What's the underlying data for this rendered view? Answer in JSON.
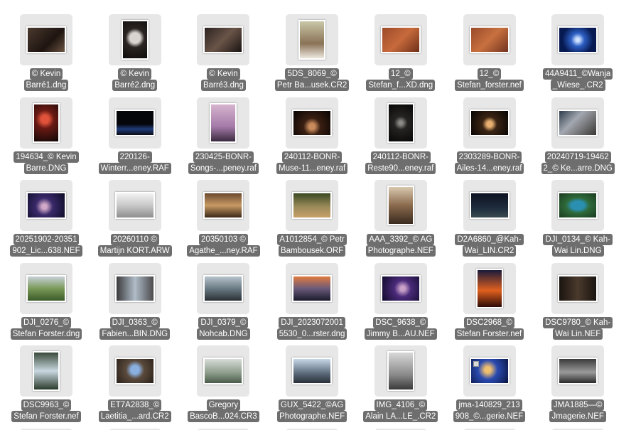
{
  "files": [
    {
      "line1": "© Kevin",
      "line2": "Barré1.dng",
      "orient": "l",
      "bg": "linear-gradient(135deg,#4a3a2e,#1e1410 60%,#6b5542)"
    },
    {
      "line1": "© Kevin",
      "line2": "Barré2.dng",
      "orient": "p",
      "bg": "radial-gradient(circle at 50% 45%,#d9d4cf 0 22%,#2a2522 40%,#0e0c0b)"
    },
    {
      "line1": "© Kevin",
      "line2": "Barré3.dng",
      "orient": "l",
      "bg": "linear-gradient(135deg,#2b2320,#6a5448 50%,#1a1412)"
    },
    {
      "line1": "5DS_8069_©",
      "line2": "Petr Ba...usek.CR2",
      "orient": "p",
      "bg": "linear-gradient(180deg,#c9c7a8,#8a7256 60%,#ece8df)"
    },
    {
      "line1": "12_©",
      "line2": "Stefan_f...XD.dng",
      "orient": "l",
      "bg": "linear-gradient(135deg,#9c4a2a,#c76a3c 50%,#6e2f18)"
    },
    {
      "line1": "12_©",
      "line2": "Stefan_forster.nef",
      "orient": "l",
      "bg": "linear-gradient(135deg,#9a4b2c,#c8703f 50%,#733420)"
    },
    {
      "line1": "44A9411_©Wanja",
      "line2": "_Wiese_.CR2",
      "orient": "l",
      "bg": "radial-gradient(circle at 50% 50%,#cfe2ff 0 8%,#2d5fc4 30%,#071a52 70%)"
    },
    {
      "line1": "194634_© Kevin",
      "line2": "Barre.DNG",
      "orient": "p",
      "bg": "radial-gradient(circle at 45% 40%,#e0533a 0 15%,#6a1a14 35%,#0d0706)"
    },
    {
      "line1": "220126-",
      "line2": "Winterr...eney.RAF",
      "orient": "l",
      "bg": "linear-gradient(180deg,#05060a 55%,#1f3c7a 75%,#0a0d16)"
    },
    {
      "line1": "230425-BONR-",
      "line2": "Songs-...peney.raf",
      "orient": "p",
      "bg": "linear-gradient(180deg,#d6b4ce,#a47aa8 60%,#3a2a40)"
    },
    {
      "line1": "240112-BONR-",
      "line2": "Muse-11...eney.raf",
      "orient": "l",
      "bg": "radial-gradient(circle at 50% 65%,#c98a5c 0 12%,#3a1f12 35%,#060403)"
    },
    {
      "line1": "240112-BONR-",
      "line2": "Reste90...eney.raf",
      "orient": "p",
      "bg": "radial-gradient(circle at 50% 50%,#8c8a86 0 8%,#262422 30%,#070707)"
    },
    {
      "line1": "2303289-BONR-",
      "line2": "Ailes-14...eney.raf",
      "orient": "l",
      "bg": "radial-gradient(circle at 50% 55%,#e8b070 0 12%,#3a2414 32%,#050403)"
    },
    {
      "line1": "20240719-19462",
      "line2": "2_© Ke...arre.DNG",
      "orient": "l",
      "bg": "linear-gradient(135deg,#2c3a4a,#a3a8b0 40%,#3b3734)"
    },
    {
      "line1": "20251902-20351",
      "line2": "902_Lic...638.NEF",
      "orient": "l",
      "bg": "radial-gradient(circle at 45% 55%,#d0a8c8 0 10%,#3a2a6a 35%,#0c0a24)"
    },
    {
      "line1": "20260110 ©",
      "line2": "Martijn KORT.ARW",
      "orient": "l",
      "bg": "linear-gradient(180deg,#f2f2f2,#c8c8c8 50%,#8e8e8e)"
    },
    {
      "line1": "20350103 ©",
      "line2": "Agathe_...ney.RAF",
      "orient": "l",
      "bg": "linear-gradient(180deg,#6a4a30,#c89a64 50%,#3a2818)"
    },
    {
      "line1": "A1012854_© Petr",
      "line2": "Bambousek.ORF",
      "orient": "l",
      "bg": "linear-gradient(180deg,#3a4a22,#9a8a5a 55%,#c8a068)"
    },
    {
      "line1": "AAA_3392_© AG",
      "line2": "Photographe.NEF",
      "orient": "p",
      "bg": "linear-gradient(180deg,#d8c8b0,#8a6a4c 50%,#3a2a20)"
    },
    {
      "line1": "D2A6860_@Kah-",
      "line2": "Wai_LIN.CR2",
      "orient": "l",
      "bg": "linear-gradient(180deg,#0c1220,#1e2c3c 60%,#3a4a50)"
    },
    {
      "line1": "DJI_0134_© Kah-",
      "line2": "Wai Lin.DNG",
      "orient": "l",
      "bg": "radial-gradient(ellipse at 50% 50%,#2a8fb0 0 25%,#2f6a3a 45%,#1a3a1e)"
    },
    {
      "line1": "DJI_0276_©",
      "line2": "Stefan Forster.dng",
      "orient": "l",
      "bg": "linear-gradient(180deg,#c8d0d8,#7a9a58 50%,#3a5a2a)"
    },
    {
      "line1": "DJI_0363_©",
      "line2": "Fabien...BIN.DNG",
      "orient": "l",
      "bg": "linear-gradient(90deg,#3a3a3c,#b0bcc8 50%,#4a4a4c)"
    },
    {
      "line1": "DJI_0379_©",
      "line2": "Nohcab.DNG",
      "orient": "l",
      "bg": "linear-gradient(180deg,#b8c4cc,#6a7a84 50%,#2a3034)"
    },
    {
      "line1": "DJI_2023072001",
      "line2": "5530_0...rster.dng",
      "orient": "l",
      "bg": "linear-gradient(180deg,#e07a40,#6a5a7a 50%,#1a1a2a)"
    },
    {
      "line1": "DSC_9638_©",
      "line2": "Jimmy B...AU.NEF",
      "orient": "l",
      "bg": "radial-gradient(circle at 55% 50%,#c8a0c8 0 10%,#4a2a7a 35%,#100a2a)"
    },
    {
      "line1": "DSC2968_©",
      "line2": "Stefan Forster.nef",
      "orient": "p",
      "bg": "linear-gradient(180deg,#1a1a3a,#e06020 55%,#2a0a04)"
    },
    {
      "line1": "DSC9780_© Kah-",
      "line2": "Wai Lin.NEF",
      "orient": "l",
      "bg": "linear-gradient(90deg,#1a1410,#4a3a2c 50%,#1a1410)"
    },
    {
      "line1": "DSC9963_©",
      "line2": "Stefan Forster.nef",
      "orient": "p",
      "bg": "linear-gradient(180deg,#3a4a3a,#c8d8e0 50%,#2a3a2a)"
    },
    {
      "line1": "ET7A2838_©",
      "line2": "Laetitia_...ard.CR2",
      "orient": "l",
      "bg": "radial-gradient(circle at 50% 45%,#8ab0e0 0 18%,#5a4a3c 40%,#2a2018)"
    },
    {
      "line1": "Gregory",
      "line2": "BascoB...024.CR3",
      "orient": "l",
      "bg": "linear-gradient(180deg,#d8dcd8,#8a9a88 60%,#4a5a48)"
    },
    {
      "line1": "GUX_5422_©AG",
      "line2": "Photographe.NEF",
      "orient": "l",
      "bg": "linear-gradient(180deg,#c8d8e8,#5a6a7a 60%,#2a3038)"
    },
    {
      "line1": "IMG_4106_©",
      "line2": "Alain LA...LE_.CR2",
      "orient": "p",
      "bg": "linear-gradient(180deg,#d8d8d8,#8a8a8a 60%,#3a3a3a)"
    },
    {
      "line1": "jma-140829_213",
      "line2": "908_©...gerie.NEF",
      "orient": "l",
      "bg": "radial-gradient(circle at 45% 45%,#f0c070 0 12%,#2a4ab0 40%,#0a1440)",
      "badge": true
    },
    {
      "line1": "JMA1885—©",
      "line2": "Jmagerie.NEF",
      "orient": "l",
      "bg": "linear-gradient(180deg,#3a3a3a,#9a9a9a 55%,#2a2a2a)"
    }
  ]
}
